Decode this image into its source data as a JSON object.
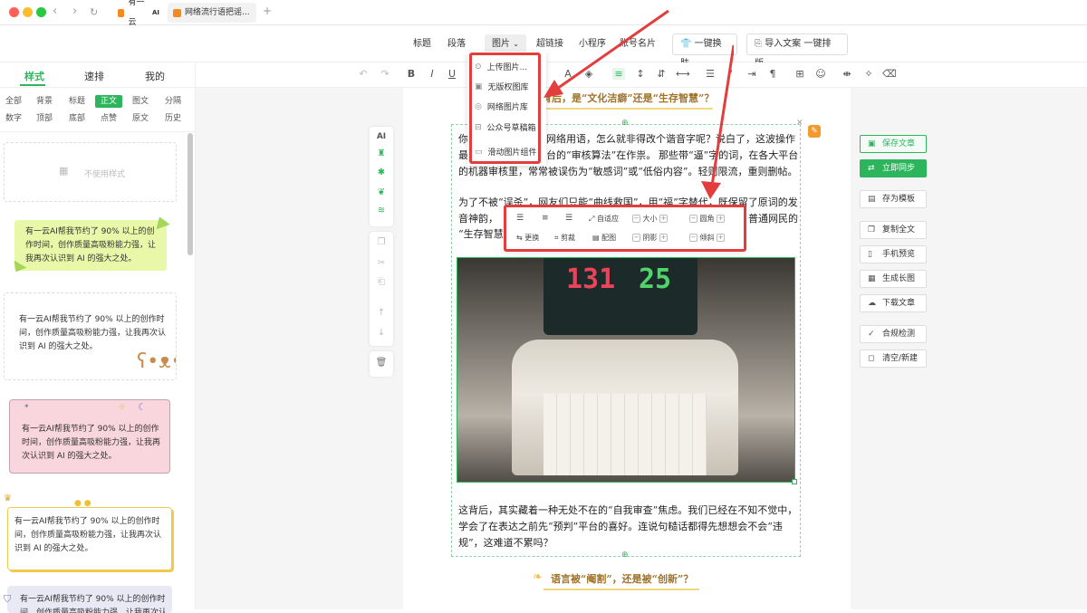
{
  "browser": {
    "tabs": [
      {
        "label": "有一云"
      },
      {
        "label": "网络流行语把谣..."
      }
    ],
    "new_tab": "+",
    "nav": {
      "back": "‹",
      "forward": "›",
      "reload": "↻"
    }
  },
  "toolbar": {
    "items": [
      "标题",
      "段落",
      "图片",
      "超链接",
      "小程序",
      "账号名片"
    ],
    "image_caret": "⌄",
    "skin_label": "一键换肤",
    "import_label": "导入文案 一键排版"
  },
  "image_menu": {
    "items": [
      "上传图片...",
      "无版权图库",
      "网络图片库",
      "公众号草稿箱",
      "滑动图片组件"
    ]
  },
  "left_panel": {
    "tabs": [
      "样式",
      "速排",
      "我的"
    ],
    "categories_row1": [
      "全部",
      "背景",
      "标题",
      "正文",
      "图文",
      "分隔"
    ],
    "categories_row2": [
      "数字",
      "顶部",
      "底部",
      "点赞",
      "原文",
      "历史"
    ],
    "no_style": "不使用样式",
    "sample_text": "有一云AI帮我节约了 90% 以上的创作时间，创作质量高吸粉能力强，让我再次认识到 AI 的强大之处。"
  },
  "article": {
    "heading1": "背后，是“文化洁癖”还是“生存智慧”？",
    "p1_line1_left": "你",
    "p1_line1_mid": "网络用语，怎么就非得改个谐音字呢？说白了，这波操作",
    "p1_line2_left": "最",
    "p1_line2_mid": "台的“审核算法”在作祟。",
    "p1_line2_right": "那些带“逼”字的词，在各大平台",
    "p1_line3": "的机器审核里，常常被误伤为“敏感词”或“低俗内容”。轻则限流，重则删帖。",
    "p2_line1": "为了不被“误杀”，网友们只能“曲线救国”，用“福”字替代，既保留了原词的发",
    "p2_line2_left": "音神韵，",
    "p2_line2_right": "普通网民的",
    "p2_line3_left": "“生存智慧”",
    "p3_line1": "这背后，其实藏着一种无处不在的“自我审查”焦虑。我们已经在不知不觉中，",
    "p3_line2": "学会了在表达之前先“预判”平台的喜好。连说句糙话都得先想想会不会“违",
    "p3_line3": "规”，这难道不累吗？",
    "heading2": "语言被“阉割”，还是被“创新”？",
    "monitor_left": "131",
    "monitor_right": "25"
  },
  "image_toolbar": {
    "fit": "自适应",
    "size": "大小",
    "radius": "圆角",
    "replace": "更换",
    "crop": "剪裁",
    "caption": "配图",
    "shadow": "阴影",
    "tilt": "倾斜"
  },
  "side_tools": {
    "ai": "AI"
  },
  "right_actions": [
    "保存文章",
    "立即同步",
    "存为模板",
    "复制全文",
    "手机预览",
    "生成长图",
    "下载文章",
    "合规检测",
    "清空/新建"
  ],
  "colors": {
    "accent": "#2db55d",
    "highlight": "#e43d3d"
  }
}
